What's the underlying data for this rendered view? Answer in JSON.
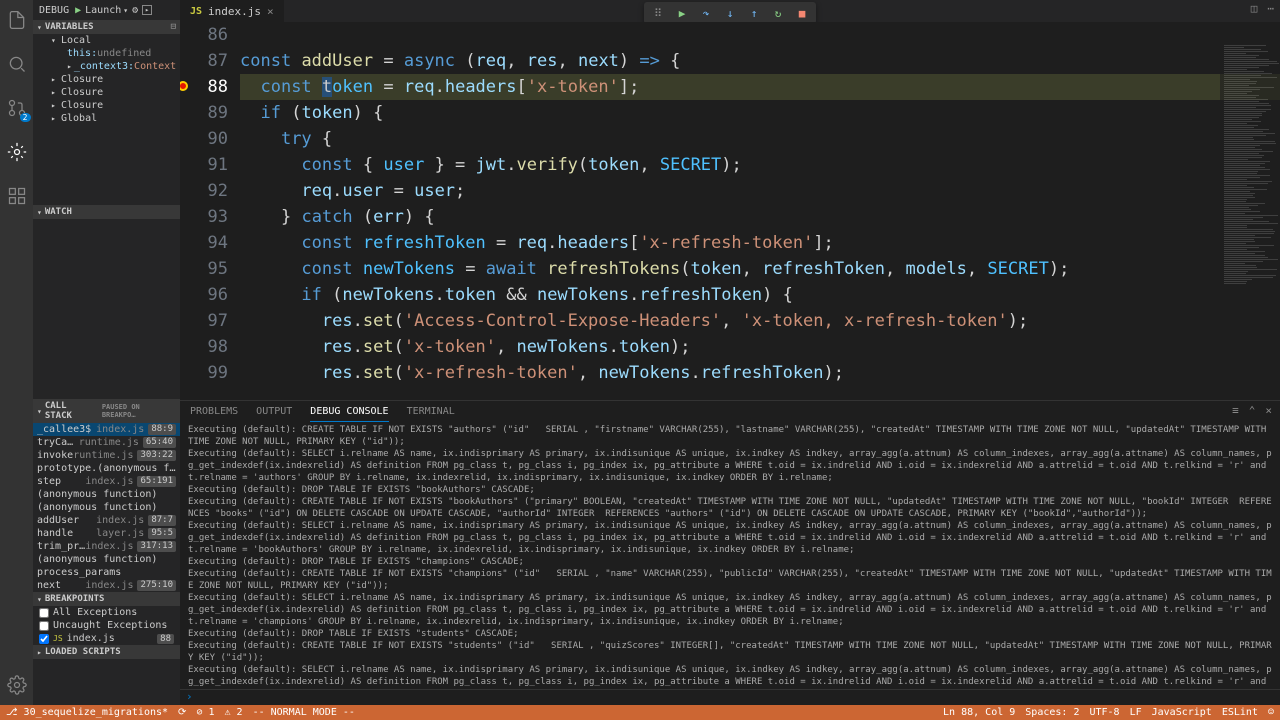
{
  "topbar": {
    "debug_label": "DEBUG",
    "launch_label": "Launch"
  },
  "tab": {
    "filename": "index.js"
  },
  "sidebar": {
    "variables_title": "VARIABLES",
    "local_label": "Local",
    "this_label": "this:",
    "this_value": "undefined",
    "context_label": "_context3:",
    "context_value": "Context {tryEntri…",
    "closure_labels": [
      "Closure",
      "Closure",
      "Closure"
    ],
    "global_label": "Global",
    "watch_title": "WATCH",
    "callstack_title": "CALL STACK",
    "paused_label": "PAUSED ON BREAKPO…",
    "stack": [
      {
        "fn": "_callee3$",
        "file": "index.js",
        "line": "88:9"
      },
      {
        "fn": "tryCatch",
        "file": "runtime.js",
        "line": "65:40"
      },
      {
        "fn": "invoke",
        "file": "runtime.js",
        "line": "303:22"
      },
      {
        "fn": "prototype.(anonymous functi…",
        "file": "",
        "line": ""
      },
      {
        "fn": "step",
        "file": "index.js",
        "line": "65:191"
      },
      {
        "fn": "(anonymous function)",
        "file": "",
        "line": ""
      },
      {
        "fn": "(anonymous function)",
        "file": "",
        "line": ""
      },
      {
        "fn": "addUser",
        "file": "index.js",
        "line": "87:7"
      },
      {
        "fn": "handle",
        "file": "layer.js",
        "line": "95:5"
      },
      {
        "fn": "trim_prefix",
        "file": "index.js",
        "line": "317:13"
      },
      {
        "fn": "(anonymous function)",
        "file": "",
        "line": ""
      },
      {
        "fn": "process_params",
        "file": "",
        "line": ""
      },
      {
        "fn": "next",
        "file": "index.js",
        "line": "275:10"
      }
    ],
    "breakpoints_title": "BREAKPOINTS",
    "bp_all": "All Exceptions",
    "bp_uncaught": "Uncaught Exceptions",
    "bp_file": "index.js",
    "bp_line": "88",
    "loaded_scripts_title": "LOADED SCRIPTS"
  },
  "editor": {
    "lines": [
      {
        "n": 86,
        "html": " "
      },
      {
        "n": 87,
        "html": "<span class='kw'>const</span> <span class='fn'>addUser</span> <span class='punct'>=</span> <span class='kw'>async</span> <span class='punct'>(</span><span class='param'>req</span><span class='punct'>,</span> <span class='param'>res</span><span class='punct'>,</span> <span class='param'>next</span><span class='punct'>)</span> <span class='arrow-fn'>=&gt;</span> <span class='punct'>{</span>"
      },
      {
        "n": 88,
        "html": "  <span class='kw'>const</span> <span class='cursor-hl'>t</span><span class='const-name'>oken</span> <span class='punct'>=</span> <span class='param'>req</span><span class='punct'>.</span><span class='prop'>headers</span><span class='punct'>[</span><span class='str'>'x-token'</span><span class='punct'>];</span>",
        "hl": true,
        "bp": true
      },
      {
        "n": 89,
        "html": "  <span class='kw'>if</span> <span class='punct'>(</span><span class='param'>token</span><span class='punct'>) {</span>"
      },
      {
        "n": 90,
        "html": "    <span class='kw'>try</span> <span class='punct'>{</span>"
      },
      {
        "n": 91,
        "html": "      <span class='kw'>const</span> <span class='punct'>{</span> <span class='const-name'>user</span> <span class='punct'>} =</span> <span class='param'>jwt</span><span class='punct'>.</span><span class='fn'>verify</span><span class='punct'>(</span><span class='param'>token</span><span class='punct'>,</span> <span class='const-name'>SECRET</span><span class='punct'>);</span>"
      },
      {
        "n": 92,
        "html": "      <span class='param'>req</span><span class='punct'>.</span><span class='prop'>user</span> <span class='punct'>=</span> <span class='param'>user</span><span class='punct'>;</span>"
      },
      {
        "n": 93,
        "html": "    <span class='punct'>}</span> <span class='kw'>catch</span> <span class='punct'>(</span><span class='param'>err</span><span class='punct'>) {</span>"
      },
      {
        "n": 94,
        "html": "      <span class='kw'>const</span> <span class='const-name'>refreshToken</span> <span class='punct'>=</span> <span class='param'>req</span><span class='punct'>.</span><span class='prop'>headers</span><span class='punct'>[</span><span class='str'>'x-refresh-token'</span><span class='punct'>];</span>"
      },
      {
        "n": 95,
        "html": "      <span class='kw'>const</span> <span class='const-name'>newTokens</span> <span class='punct'>=</span> <span class='kw'>await</span> <span class='fn'>refreshTokens</span><span class='punct'>(</span><span class='param'>token</span><span class='punct'>,</span> <span class='param'>refreshToken</span><span class='punct'>,</span> <span class='param'>models</span><span class='punct'>,</span> <span class='const-name'>SECRET</span><span class='punct'>);</span>"
      },
      {
        "n": 96,
        "html": "      <span class='kw'>if</span> <span class='punct'>(</span><span class='param'>newTokens</span><span class='punct'>.</span><span class='prop'>token</span> <span class='punct'>&amp;&amp;</span> <span class='param'>newTokens</span><span class='punct'>.</span><span class='prop'>refreshToken</span><span class='punct'>) {</span>"
      },
      {
        "n": 97,
        "html": "        <span class='param'>res</span><span class='punct'>.</span><span class='fn'>set</span><span class='punct'>(</span><span class='str'>'Access-Control-Expose-Headers'</span><span class='punct'>,</span> <span class='str'>'x-token, x-refresh-token'</span><span class='punct'>);</span>"
      },
      {
        "n": 98,
        "html": "        <span class='param'>res</span><span class='punct'>.</span><span class='fn'>set</span><span class='punct'>(</span><span class='str'>'x-token'</span><span class='punct'>,</span> <span class='param'>newTokens</span><span class='punct'>.</span><span class='prop'>token</span><span class='punct'>);</span>"
      },
      {
        "n": 99,
        "html": "        <span class='param'>res</span><span class='punct'>.</span><span class='fn'>set</span><span class='punct'>(</span><span class='str'>'x-refresh-token'</span><span class='punct'>,</span> <span class='param'>newTokens</span><span class='punct'>.</span><span class='prop'>refreshToken</span><span class='punct'>);</span>"
      }
    ]
  },
  "panel": {
    "tabs": [
      "PROBLEMS",
      "OUTPUT",
      "DEBUG CONSOLE",
      "TERMINAL"
    ],
    "active_tab": 2,
    "log": "Executing (default): CREATE TABLE IF NOT EXISTS \"authors\" (\"id\"   SERIAL , \"firstname\" VARCHAR(255), \"lastname\" VARCHAR(255), \"createdAt\" TIMESTAMP WITH TIME ZONE NOT NULL, \"updatedAt\" TIMESTAMP WITH TIME ZONE NOT NULL, PRIMARY KEY (\"id\"));\nExecuting (default): SELECT i.relname AS name, ix.indisprimary AS primary, ix.indisunique AS unique, ix.indkey AS indkey, array_agg(a.attnum) AS column_indexes, array_agg(a.attname) AS column_names, pg_get_indexdef(ix.indexrelid) AS definition FROM pg_class t, pg_class i, pg_index ix, pg_attribute a WHERE t.oid = ix.indrelid AND i.oid = ix.indexrelid AND a.attrelid = t.oid AND t.relkind = 'r' and t.relname = 'authors' GROUP BY i.relname, ix.indexrelid, ix.indisprimary, ix.indisunique, ix.indkey ORDER BY i.relname;\nExecuting (default): DROP TABLE IF EXISTS \"bookAuthors\" CASCADE;\nExecuting (default): CREATE TABLE IF NOT EXISTS \"bookAuthors\" (\"primary\" BOOLEAN, \"createdAt\" TIMESTAMP WITH TIME ZONE NOT NULL, \"updatedAt\" TIMESTAMP WITH TIME ZONE NOT NULL, \"bookId\" INTEGER  REFERENCES \"books\" (\"id\") ON DELETE CASCADE ON UPDATE CASCADE, \"authorId\" INTEGER  REFERENCES \"authors\" (\"id\") ON DELETE CASCADE ON UPDATE CASCADE, PRIMARY KEY (\"bookId\",\"authorId\"));\nExecuting (default): SELECT i.relname AS name, ix.indisprimary AS primary, ix.indisunique AS unique, ix.indkey AS indkey, array_agg(a.attnum) AS column_indexes, array_agg(a.attname) AS column_names, pg_get_indexdef(ix.indexrelid) AS definition FROM pg_class t, pg_class i, pg_index ix, pg_attribute a WHERE t.oid = ix.indrelid AND i.oid = ix.indexrelid AND a.attrelid = t.oid AND t.relkind = 'r' and t.relname = 'bookAuthors' GROUP BY i.relname, ix.indexrelid, ix.indisprimary, ix.indisunique, ix.indkey ORDER BY i.relname;\nExecuting (default): DROP TABLE IF EXISTS \"champions\" CASCADE;\nExecuting (default): CREATE TABLE IF NOT EXISTS \"champions\" (\"id\"   SERIAL , \"name\" VARCHAR(255), \"publicId\" VARCHAR(255), \"createdAt\" TIMESTAMP WITH TIME ZONE NOT NULL, \"updatedAt\" TIMESTAMP WITH TIME ZONE NOT NULL, PRIMARY KEY (\"id\"));\nExecuting (default): SELECT i.relname AS name, ix.indisprimary AS primary, ix.indisunique AS unique, ix.indkey AS indkey, array_agg(a.attnum) AS column_indexes, array_agg(a.attname) AS column_names, pg_get_indexdef(ix.indexrelid) AS definition FROM pg_class t, pg_class i, pg_index ix, pg_attribute a WHERE t.oid = ix.indrelid AND i.oid = ix.indexrelid AND a.attrelid = t.oid AND t.relkind = 'r' and t.relname = 'champions' GROUP BY i.relname, ix.indexrelid, ix.indisprimary, ix.indisunique, ix.indkey ORDER BY i.relname;\nExecuting (default): DROP TABLE IF EXISTS \"students\" CASCADE;\nExecuting (default): CREATE TABLE IF NOT EXISTS \"students\" (\"id\"   SERIAL , \"quizScores\" INTEGER[], \"createdAt\" TIMESTAMP WITH TIME ZONE NOT NULL, \"updatedAt\" TIMESTAMP WITH TIME ZONE NOT NULL, PRIMARY KEY (\"id\"));\nExecuting (default): SELECT i.relname AS name, ix.indisprimary AS primary, ix.indisunique AS unique, ix.indkey AS indkey, array_agg(a.attnum) AS column_indexes, array_agg(a.attname) AS column_names, pg_get_indexdef(ix.indexrelid) AS definition FROM pg_class t, pg_class i, pg_index ix, pg_attribute a WHERE t.oid = ix.indrelid AND i.oid = ix.indexrelid AND a.attrelid = t.oid AND t.relkind = 'r' and t.relname = 'students' GROUP BY i.relname, ix.indexrelid, ix.indisprimary, ix.indisunique, ix.indkey ORDER BY i.relname;"
  },
  "status": {
    "branch": "30_sequelize_migrations*",
    "errors": "⊘ 1",
    "warnings": "⚠ 2",
    "mode": "-- NORMAL MODE --",
    "ln_col": "Ln 88, Col 9",
    "spaces": "Spaces: 2",
    "encoding": "UTF-8",
    "eol": "LF",
    "lang": "JavaScript",
    "eslint": "ESLint"
  }
}
